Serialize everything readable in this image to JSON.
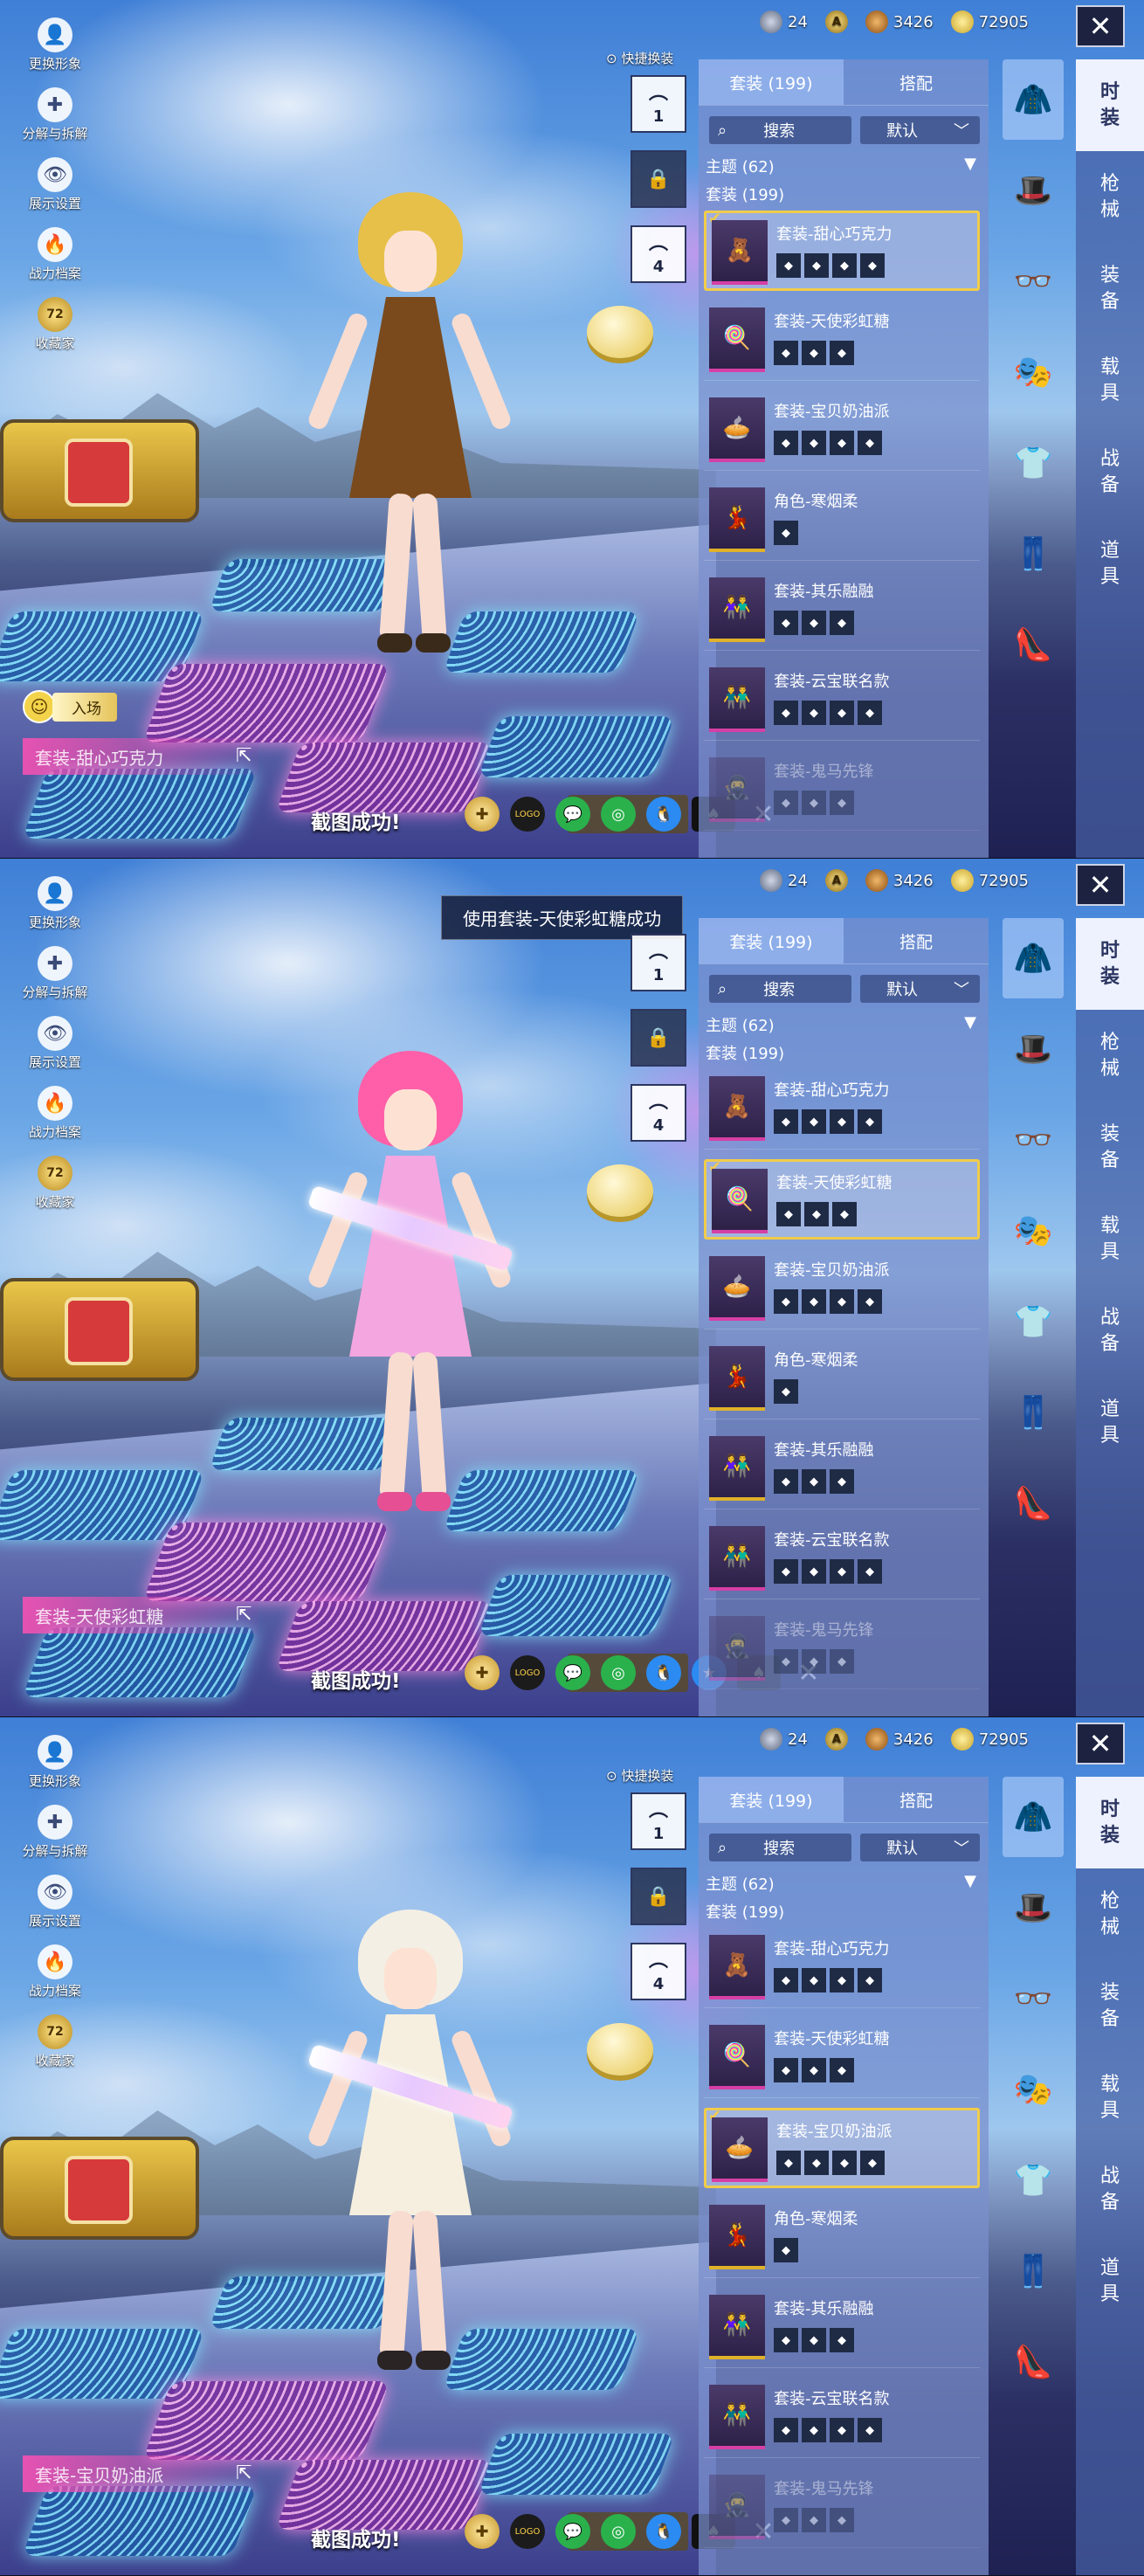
{
  "left_menu": [
    {
      "label": "更换形象",
      "icon": "user-icon"
    },
    {
      "label": "分解与拆解",
      "icon": "puzzle-icon"
    },
    {
      "label": "展示设置",
      "icon": "eye-icon"
    },
    {
      "label": "战力档案",
      "icon": "flame-icon"
    },
    {
      "label": "收藏家",
      "icon": "badge-icon",
      "badge": "72"
    }
  ],
  "entry_label": "入场",
  "screenshot_msg": "截图成功!",
  "quick_change": "快捷换装",
  "hangers": [
    {
      "n": "1"
    },
    {
      "n": ""
    },
    {
      "n": "4"
    }
  ],
  "currency": [
    {
      "value": "24"
    },
    {
      "value": "A"
    },
    {
      "value": "3426"
    },
    {
      "value": "72905"
    }
  ],
  "close": "✕",
  "tabs": {
    "suits": "套装 (199)",
    "match": "搭配"
  },
  "search_label": "搜索",
  "sort_label": "默认",
  "category": "主题 (62)",
  "subcategory": "套装 (199)",
  "items": [
    "套装-甜心巧克力",
    "套装-天使彩虹糖",
    "套装-宝贝奶油派",
    "角色-寒烟柔",
    "套装-其乐融融",
    "套装-云宝联名款",
    "套装-鬼马先锋"
  ],
  "right_categories": [
    "时装",
    "枪械",
    "装备",
    "载具",
    "战备",
    "道具"
  ],
  "accent": "#f1cc4b",
  "panels": [
    {
      "equipped": "套装-甜心巧克力",
      "selected_index": 0,
      "toast": "",
      "hair": "#e7c04a",
      "dress": "#7a4a1c",
      "shoe": "#3a2a1a",
      "gun": false
    },
    {
      "equipped": "套装-天使彩虹糖",
      "selected_index": 1,
      "toast": "使用套装-天使彩虹糖成功",
      "hair": "#ff5fa8",
      "dress": "#f3a6e0",
      "shoe": "#e64f94",
      "gun": true
    },
    {
      "equipped": "套装-宝贝奶油派",
      "selected_index": 2,
      "toast": "",
      "hair": "#f4efe4",
      "dress": "#f6efdf",
      "shoe": "#2a2424",
      "gun": true
    }
  ]
}
